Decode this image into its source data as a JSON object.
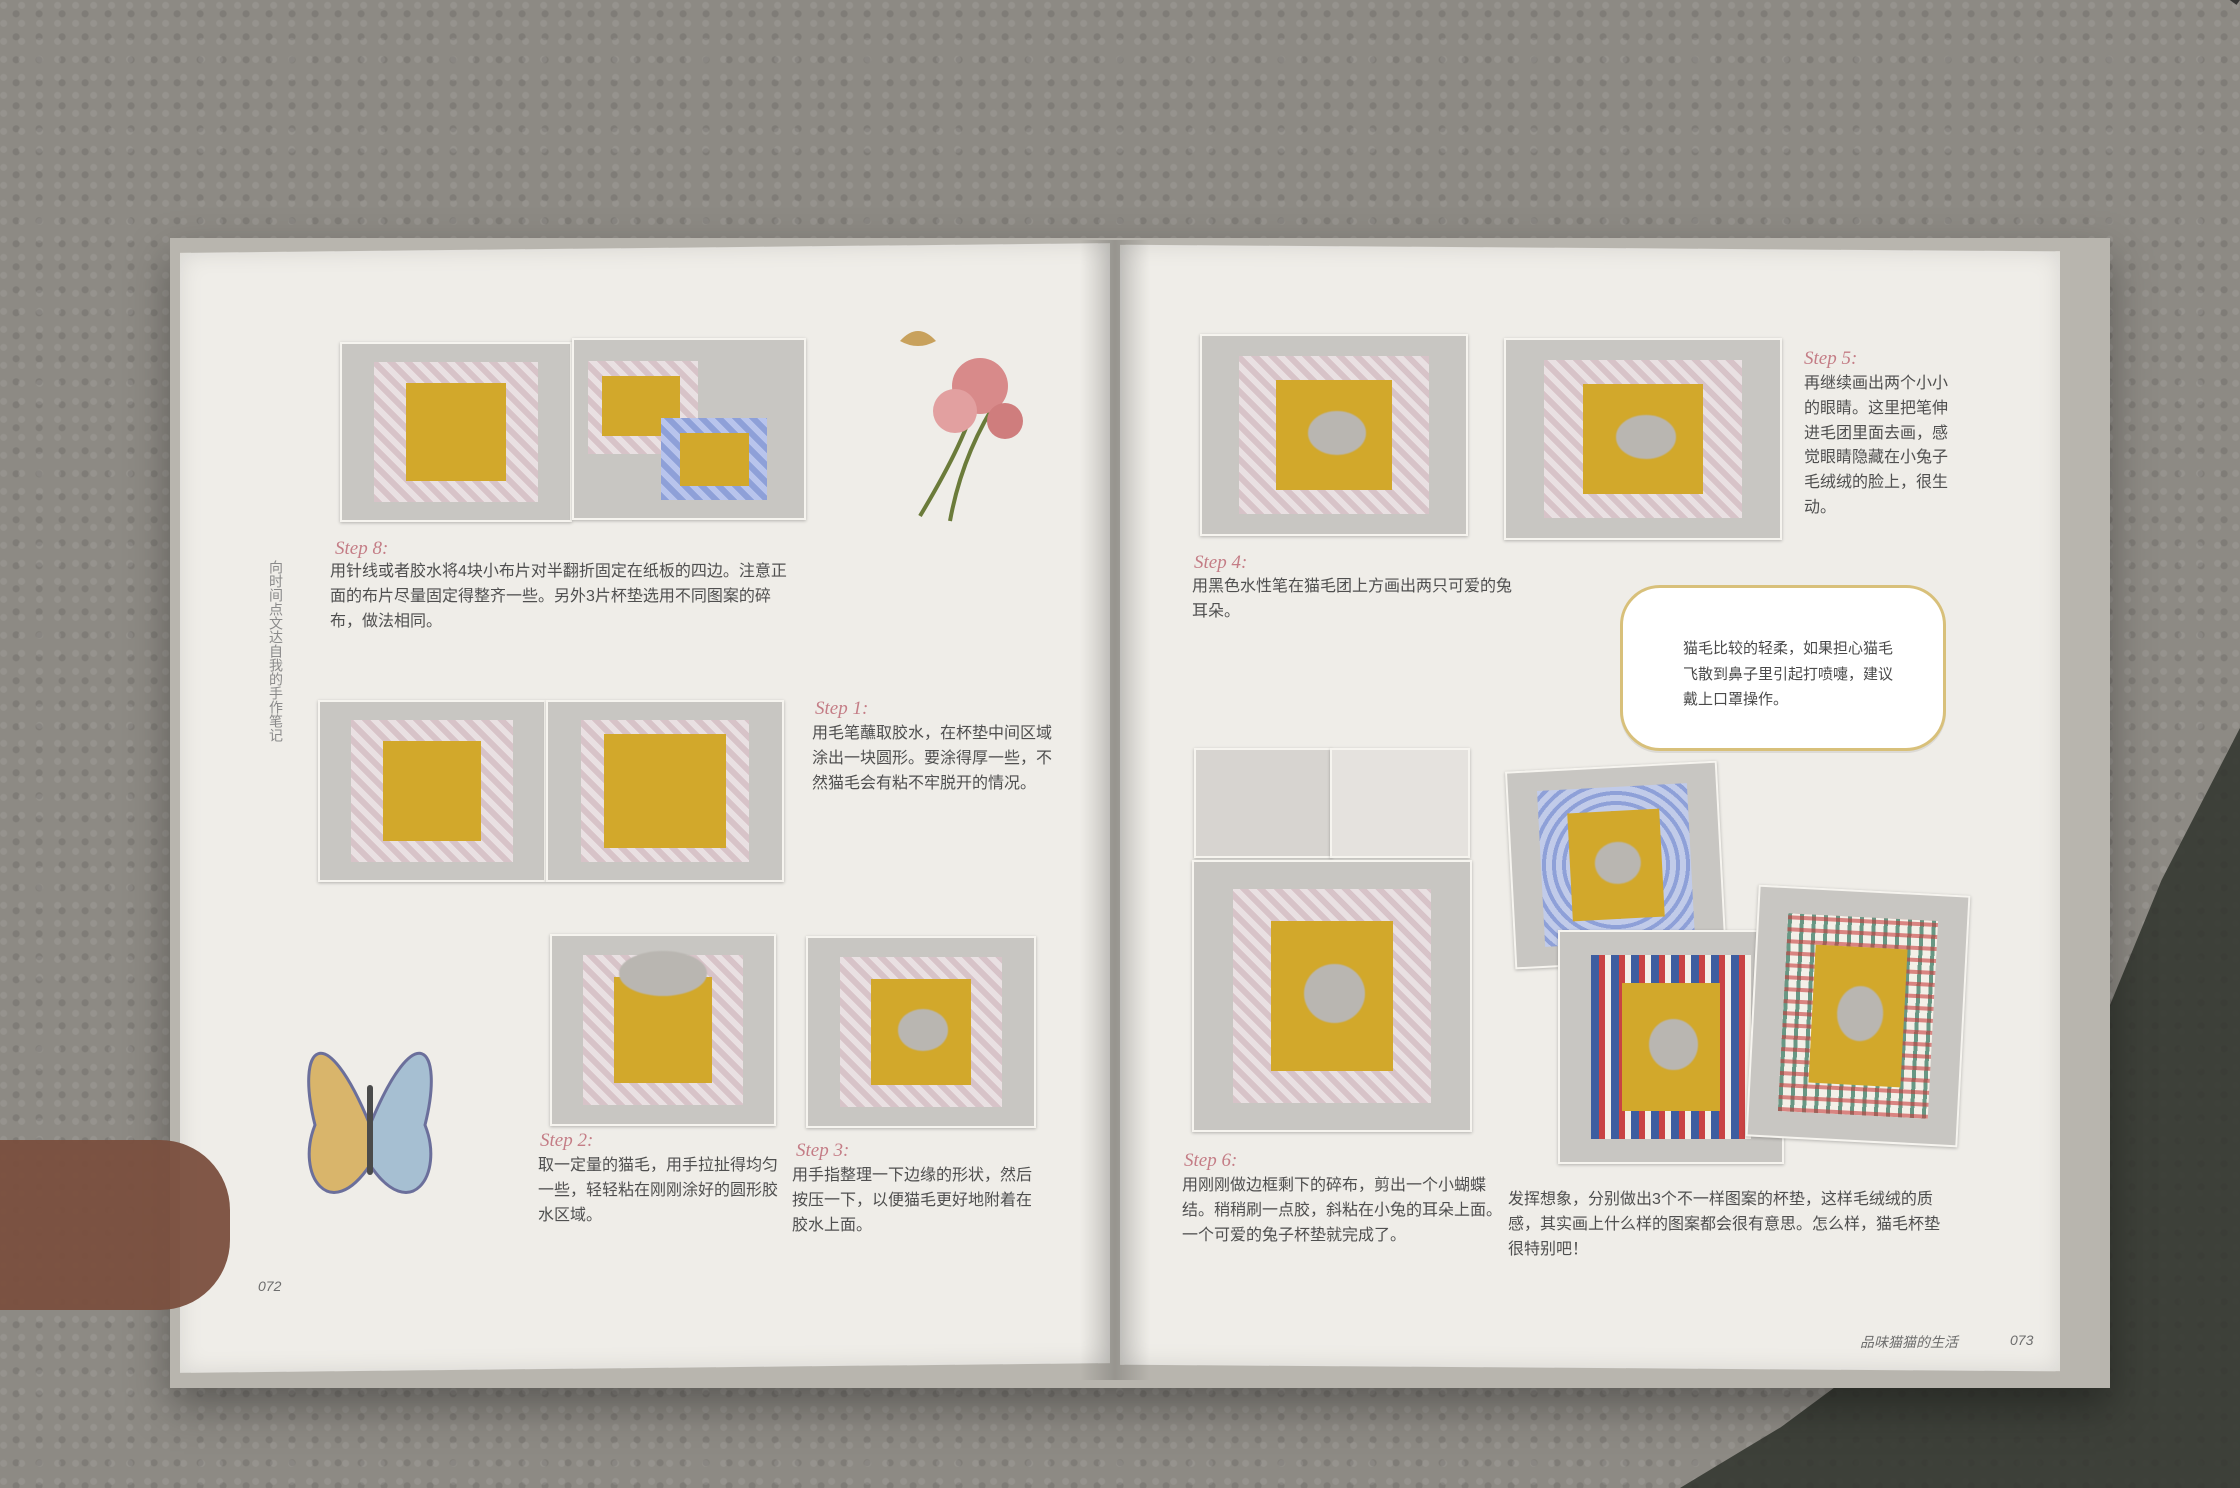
{
  "book": {
    "left_page_number": "072",
    "right_page_number": "073",
    "left_vertical_title": "向时间点文达自我的手作笔记",
    "right_footer_title": "品味猫猫的生活"
  },
  "left_page": {
    "step8": {
      "label": "Step 8:",
      "text": "用针线或者胶水将4块小布片对半翻折固定在纸板的四边。注意正面的布片尽量固定得整齐一些。另外3片杯垫选用不同图案的碎布，做法相同。"
    },
    "step1": {
      "label": "Step 1:",
      "text": "用毛笔蘸取胶水，在杯垫中间区域涂出一块圆形。要涂得厚一些，不然猫毛会有粘不牢脱开的情况。"
    },
    "step2": {
      "label": "Step 2:",
      "text": "取一定量的猫毛，用手拉扯得均匀一些，轻轻粘在刚刚涂好的圆形胶水区域。"
    },
    "step3": {
      "label": "Step 3:",
      "text": "用手指整理一下边缘的形状，然后按压一下，以便猫毛更好地附着在胶水上面。"
    }
  },
  "right_page": {
    "step4": {
      "label": "Step 4:",
      "text": "用黑色水性笔在猫毛团上方画出两只可爱的兔耳朵。"
    },
    "step5": {
      "label": "Step 5:",
      "text": "再继续画出两个小小的眼睛。这里把笔伸进毛团里面去画，感觉眼睛隐藏在小兔子毛绒绒的脸上，很生动。"
    },
    "step6": {
      "label": "Step 6:",
      "text": "用刚刚做边框剩下的碎布，剪出一个小蝴蝶结。稍稍刷一点胶，斜粘在小兔的耳朵上面。一个可爱的兔子杯垫就完成了。"
    },
    "tip": "猫毛比较的轻柔，如果担心猫毛飞散到鼻子里引起打喷嚏，建议戴上口罩操作。",
    "closing": "发挥想象，分别做出3个不一样图案的杯垫，这样毛绒绒的质感，其实画上什么样的图案都会很有意思。怎么样，猫毛杯垫很特别吧！"
  },
  "colors": {
    "step_label": "#c47d86",
    "yellow_card": "#d2a82b",
    "paper": "#efede8"
  }
}
